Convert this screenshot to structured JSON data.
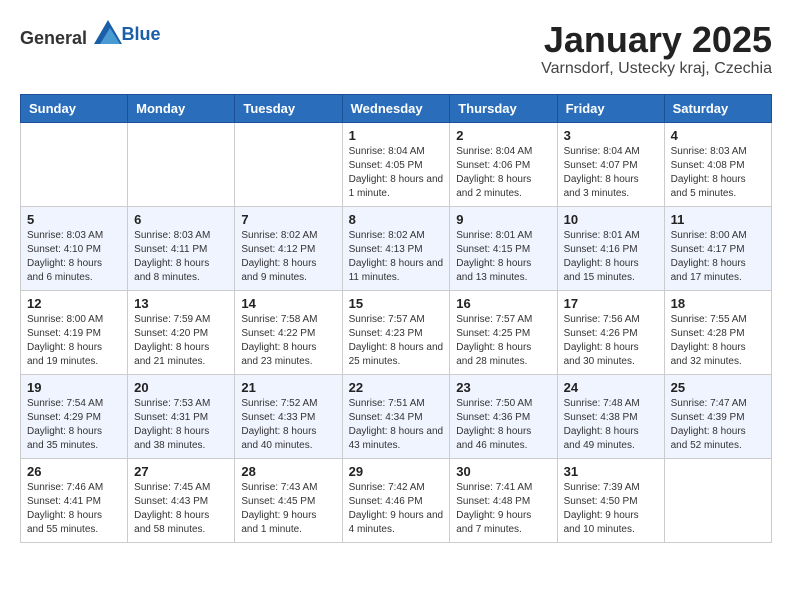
{
  "header": {
    "logo_general": "General",
    "logo_blue": "Blue",
    "title": "January 2025",
    "subtitle": "Varnsdorf, Ustecky kraj, Czechia"
  },
  "calendar": {
    "days_of_week": [
      "Sunday",
      "Monday",
      "Tuesday",
      "Wednesday",
      "Thursday",
      "Friday",
      "Saturday"
    ],
    "weeks": [
      [
        {
          "day": "",
          "info": ""
        },
        {
          "day": "",
          "info": ""
        },
        {
          "day": "",
          "info": ""
        },
        {
          "day": "1",
          "info": "Sunrise: 8:04 AM\nSunset: 4:05 PM\nDaylight: 8 hours and 1 minute."
        },
        {
          "day": "2",
          "info": "Sunrise: 8:04 AM\nSunset: 4:06 PM\nDaylight: 8 hours and 2 minutes."
        },
        {
          "day": "3",
          "info": "Sunrise: 8:04 AM\nSunset: 4:07 PM\nDaylight: 8 hours and 3 minutes."
        },
        {
          "day": "4",
          "info": "Sunrise: 8:03 AM\nSunset: 4:08 PM\nDaylight: 8 hours and 5 minutes."
        }
      ],
      [
        {
          "day": "5",
          "info": "Sunrise: 8:03 AM\nSunset: 4:10 PM\nDaylight: 8 hours and 6 minutes."
        },
        {
          "day": "6",
          "info": "Sunrise: 8:03 AM\nSunset: 4:11 PM\nDaylight: 8 hours and 8 minutes."
        },
        {
          "day": "7",
          "info": "Sunrise: 8:02 AM\nSunset: 4:12 PM\nDaylight: 8 hours and 9 minutes."
        },
        {
          "day": "8",
          "info": "Sunrise: 8:02 AM\nSunset: 4:13 PM\nDaylight: 8 hours and 11 minutes."
        },
        {
          "day": "9",
          "info": "Sunrise: 8:01 AM\nSunset: 4:15 PM\nDaylight: 8 hours and 13 minutes."
        },
        {
          "day": "10",
          "info": "Sunrise: 8:01 AM\nSunset: 4:16 PM\nDaylight: 8 hours and 15 minutes."
        },
        {
          "day": "11",
          "info": "Sunrise: 8:00 AM\nSunset: 4:17 PM\nDaylight: 8 hours and 17 minutes."
        }
      ],
      [
        {
          "day": "12",
          "info": "Sunrise: 8:00 AM\nSunset: 4:19 PM\nDaylight: 8 hours and 19 minutes."
        },
        {
          "day": "13",
          "info": "Sunrise: 7:59 AM\nSunset: 4:20 PM\nDaylight: 8 hours and 21 minutes."
        },
        {
          "day": "14",
          "info": "Sunrise: 7:58 AM\nSunset: 4:22 PM\nDaylight: 8 hours and 23 minutes."
        },
        {
          "day": "15",
          "info": "Sunrise: 7:57 AM\nSunset: 4:23 PM\nDaylight: 8 hours and 25 minutes."
        },
        {
          "day": "16",
          "info": "Sunrise: 7:57 AM\nSunset: 4:25 PM\nDaylight: 8 hours and 28 minutes."
        },
        {
          "day": "17",
          "info": "Sunrise: 7:56 AM\nSunset: 4:26 PM\nDaylight: 8 hours and 30 minutes."
        },
        {
          "day": "18",
          "info": "Sunrise: 7:55 AM\nSunset: 4:28 PM\nDaylight: 8 hours and 32 minutes."
        }
      ],
      [
        {
          "day": "19",
          "info": "Sunrise: 7:54 AM\nSunset: 4:29 PM\nDaylight: 8 hours and 35 minutes."
        },
        {
          "day": "20",
          "info": "Sunrise: 7:53 AM\nSunset: 4:31 PM\nDaylight: 8 hours and 38 minutes."
        },
        {
          "day": "21",
          "info": "Sunrise: 7:52 AM\nSunset: 4:33 PM\nDaylight: 8 hours and 40 minutes."
        },
        {
          "day": "22",
          "info": "Sunrise: 7:51 AM\nSunset: 4:34 PM\nDaylight: 8 hours and 43 minutes."
        },
        {
          "day": "23",
          "info": "Sunrise: 7:50 AM\nSunset: 4:36 PM\nDaylight: 8 hours and 46 minutes."
        },
        {
          "day": "24",
          "info": "Sunrise: 7:48 AM\nSunset: 4:38 PM\nDaylight: 8 hours and 49 minutes."
        },
        {
          "day": "25",
          "info": "Sunrise: 7:47 AM\nSunset: 4:39 PM\nDaylight: 8 hours and 52 minutes."
        }
      ],
      [
        {
          "day": "26",
          "info": "Sunrise: 7:46 AM\nSunset: 4:41 PM\nDaylight: 8 hours and 55 minutes."
        },
        {
          "day": "27",
          "info": "Sunrise: 7:45 AM\nSunset: 4:43 PM\nDaylight: 8 hours and 58 minutes."
        },
        {
          "day": "28",
          "info": "Sunrise: 7:43 AM\nSunset: 4:45 PM\nDaylight: 9 hours and 1 minute."
        },
        {
          "day": "29",
          "info": "Sunrise: 7:42 AM\nSunset: 4:46 PM\nDaylight: 9 hours and 4 minutes."
        },
        {
          "day": "30",
          "info": "Sunrise: 7:41 AM\nSunset: 4:48 PM\nDaylight: 9 hours and 7 minutes."
        },
        {
          "day": "31",
          "info": "Sunrise: 7:39 AM\nSunset: 4:50 PM\nDaylight: 9 hours and 10 minutes."
        },
        {
          "day": "",
          "info": ""
        }
      ]
    ]
  }
}
